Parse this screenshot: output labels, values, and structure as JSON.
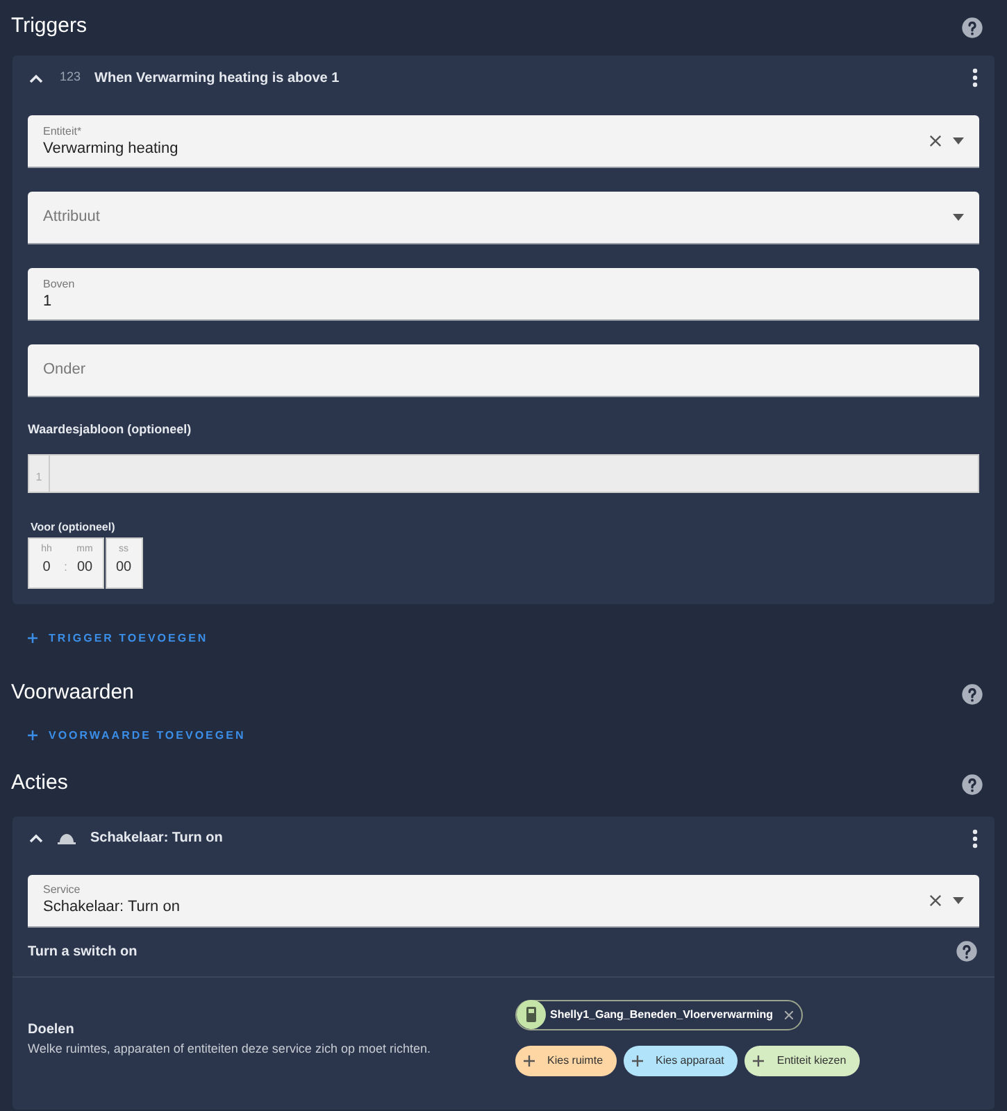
{
  "triggers": {
    "title": "Triggers",
    "cards": [
      {
        "title": "When Verwarming heating is above 1",
        "badge": "123",
        "expanded": true,
        "fields": [
          {
            "label": "Entiteit*",
            "value": "Verwarming heating",
            "clear": true,
            "dropdown": true
          },
          {
            "label": "Attribuut",
            "clear": false,
            "dropdown": true
          },
          {
            "label": "Boven",
            "value": "1",
            "clear": false,
            "dropdown": false
          },
          {
            "label": "Onder",
            "clear": false,
            "dropdown": false
          }
        ],
        "template": {
          "label": "Waardesjabloon (optioneel)",
          "line_number": "1"
        },
        "duration": {
          "label": "Voor (optioneel)",
          "separator": ":",
          "units": [
            {
              "label": "hh",
              "value": "0"
            },
            {
              "label": "mm",
              "value": "00"
            },
            {
              "label": "ss",
              "value": "00"
            }
          ]
        }
      }
    ],
    "add_button": "TRIGGER TOEVOEGEN"
  },
  "conditions": {
    "title": "Voorwaarden",
    "add_button": "VOORWAARDE TOEVOEGEN"
  },
  "actions": {
    "title": "Acties",
    "cards": [
      {
        "title": "Schakelaar: Turn on",
        "expanded": true,
        "service": {
          "label": "Service",
          "value": "Schakelaar: Turn on",
          "clear": true,
          "dropdown": true
        },
        "description": "Turn a switch on",
        "targets": {
          "title": "Doelen",
          "description": "Welke ruimtes, apparaten of entiteiten deze service zich op moet richten.",
          "selected": [
            {
              "label": "Shelly1_Gang_Beneden_Vloerverwarming",
              "color": "#c5e4a8"
            }
          ],
          "add": [
            {
              "label": "Kies ruimte",
              "color": "#fed6a4"
            },
            {
              "label": "Kies apparaat",
              "color": "#b1e4fb"
            },
            {
              "label": "Entiteit kiezen",
              "color": "#d5ecc2"
            }
          ]
        }
      }
    ]
  }
}
